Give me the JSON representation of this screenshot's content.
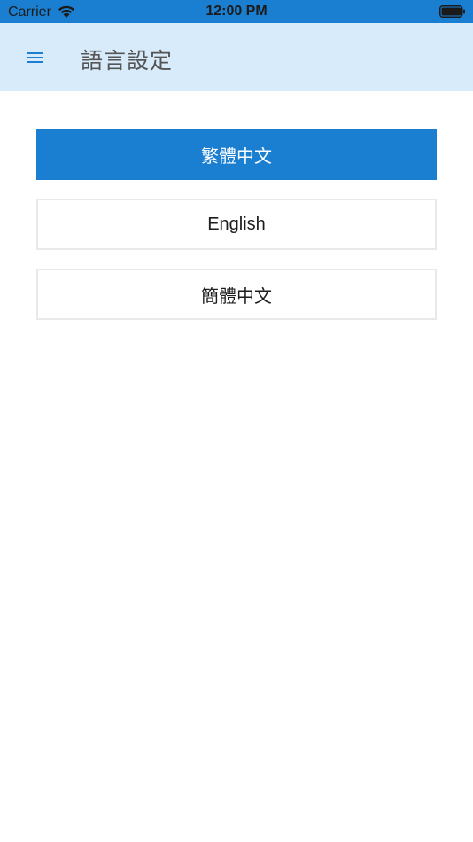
{
  "status_bar": {
    "carrier": "Carrier",
    "time": "12:00 PM",
    "icons": [
      "wifi-icon",
      "battery-icon"
    ]
  },
  "header": {
    "menu_icon": "hamburger-menu-icon",
    "title": "語言設定"
  },
  "options": [
    {
      "label": "繁體中文",
      "selected": true
    },
    {
      "label": "English",
      "selected": false
    },
    {
      "label": "簡體中文",
      "selected": false
    }
  ],
  "colors": {
    "accent": "#1a7fd1",
    "header_bg": "#d8ebfa",
    "title_text": "#555555"
  }
}
